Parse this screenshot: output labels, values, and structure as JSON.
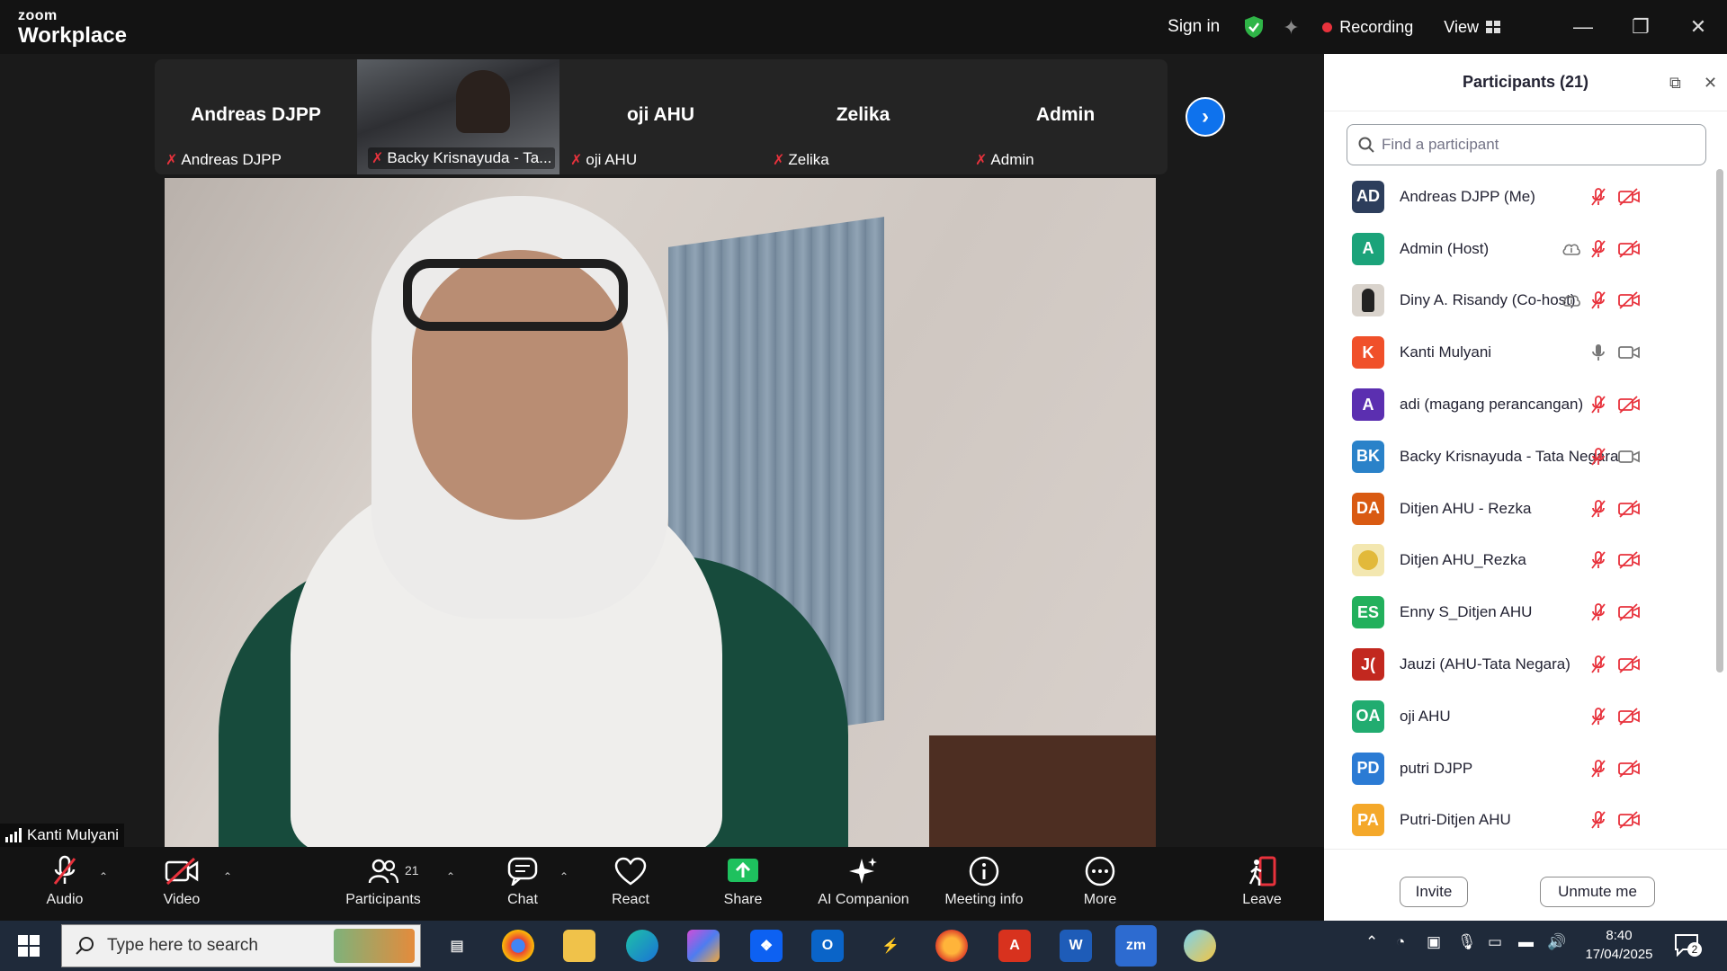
{
  "app": {
    "logo_line1": "zoom",
    "logo_line2": "Workplace"
  },
  "titlebar": {
    "signin": "Sign in",
    "recording": "Recording",
    "view": "View",
    "colors": {
      "shield": "#2fb547",
      "recording_dot": "#e8323c"
    }
  },
  "thumbnails": [
    {
      "big_name": "Andreas DJPP",
      "label": "Andreas DJPP",
      "video": false
    },
    {
      "big_name": "",
      "label": "Backy Krisnayuda - Ta...",
      "video": true
    },
    {
      "big_name": "oji AHU",
      "label": "oji AHU",
      "video": false
    },
    {
      "big_name": "Zelika",
      "label": "Zelika",
      "video": false
    },
    {
      "big_name": "Admin",
      "label": "Admin",
      "video": false
    }
  ],
  "main": {
    "speaker": "Kanti Mulyani"
  },
  "toolbar": {
    "audio": "Audio",
    "video": "Video",
    "participants": "Participants",
    "participants_count": "21",
    "chat": "Chat",
    "react": "React",
    "share": "Share",
    "ai": "AI Companion",
    "meeting_info": "Meeting info",
    "more": "More",
    "leave": "Leave"
  },
  "panel": {
    "title": "Participants (21)",
    "search_placeholder": "Find a participant",
    "invite": "Invite",
    "unmute": "Unmute me",
    "participants": [
      {
        "initials": "AD",
        "name": "Andreas DJPP (Me)",
        "color": "#2d3e5c",
        "cloud": false,
        "mic": "muted",
        "cam": "off"
      },
      {
        "initials": "A",
        "name": "Admin (Host)",
        "color": "#1ba37a",
        "cloud": true,
        "mic": "muted",
        "cam": "off"
      },
      {
        "initials": "",
        "name": "Diny A. Risandy (Co-host)",
        "color": "#d9d3cc",
        "cloud": true,
        "mic": "muted",
        "cam": "off"
      },
      {
        "initials": "K",
        "name": "Kanti Mulyani",
        "color": "#f0502a",
        "cloud": false,
        "mic": "on",
        "cam": "on"
      },
      {
        "initials": "A",
        "name": "adi (magang perancangan)",
        "color": "#5b2fb0",
        "cloud": false,
        "mic": "muted",
        "cam": "off"
      },
      {
        "initials": "BK",
        "name": "Backy Krisnayuda - Tata Negara",
        "color": "#2a82c9",
        "cloud": false,
        "mic": "muted",
        "cam": "on"
      },
      {
        "initials": "DA",
        "name": "Ditjen AHU - Rezka",
        "color": "#d95a12",
        "cloud": false,
        "mic": "muted",
        "cam": "off"
      },
      {
        "initials": "",
        "name": "Ditjen AHU_Rezka",
        "color": "#f3e7b0",
        "cloud": false,
        "mic": "muted",
        "cam": "off"
      },
      {
        "initials": "ES",
        "name": "Enny S_Ditjen AHU",
        "color": "#22b05c",
        "cloud": false,
        "mic": "muted",
        "cam": "off"
      },
      {
        "initials": "J(",
        "name": "Jauzi (AHU-Tata Negara)",
        "color": "#c2281f",
        "cloud": false,
        "mic": "muted",
        "cam": "off"
      },
      {
        "initials": "OA",
        "name": "oji AHU",
        "color": "#21ac70",
        "cloud": false,
        "mic": "muted",
        "cam": "off"
      },
      {
        "initials": "PD",
        "name": "putri DJPP",
        "color": "#2b7bd4",
        "cloud": false,
        "mic": "muted",
        "cam": "off"
      },
      {
        "initials": "PA",
        "name": "Putri-Ditjen AHU",
        "color": "#f4a82a",
        "cloud": false,
        "mic": "muted",
        "cam": "off"
      }
    ]
  },
  "taskbar": {
    "search_placeholder": "Type here to search",
    "time": "8:40",
    "date": "17/04/2025",
    "notif_count": "2"
  }
}
